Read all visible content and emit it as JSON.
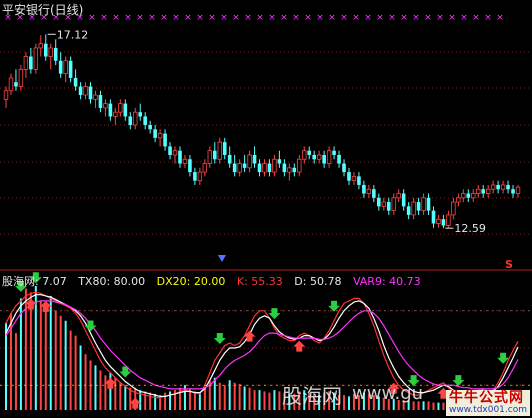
{
  "header": {
    "title": "平安银行(日线)"
  },
  "readout": {
    "indicator_name": "股海网",
    "line1": "7.07",
    "tx80": "TX80: 80.00",
    "dx20": "DX20: 20.00",
    "k": "K: 55.33",
    "d": "D: 50.78",
    "var9": "VAR9: 40.73"
  },
  "watermark": {
    "text": "股海网",
    "domain": "www.gu"
  },
  "brand": {
    "line1": "牛牛公式网",
    "line2": "www.tdx001.com"
  },
  "marker": {
    "s_label": "S"
  },
  "colors": {
    "up": "#ff4444",
    "down": "#54ffff",
    "grid": "#8b1a1a",
    "k_line": "#ff3333",
    "d_line": "#ffffff",
    "var9_line": "#ff33ff",
    "yellow": "#ffff00",
    "arrow_up": "#ff4444",
    "arrow_down": "#2ecc40",
    "cross": "#ff33ff"
  },
  "chart_data": {
    "type": "candlestick",
    "title": "平安银行(日线)",
    "price_annotations": [
      {
        "label": "17.12",
        "value": 17.12
      },
      {
        "label": "12.59",
        "value": 12.59
      }
    ],
    "price_ylim": [
      11.8,
      17.5
    ],
    "candles": [
      [
        15.6,
        15.9,
        15.4,
        15.8
      ],
      [
        15.8,
        16.2,
        15.7,
        16.1
      ],
      [
        16.0,
        16.3,
        15.8,
        15.9
      ],
      [
        15.9,
        16.4,
        15.8,
        16.3
      ],
      [
        16.3,
        16.7,
        16.1,
        16.6
      ],
      [
        16.6,
        16.8,
        16.2,
        16.3
      ],
      [
        16.3,
        16.9,
        16.2,
        16.8
      ],
      [
        16.8,
        17.1,
        16.6,
        16.9
      ],
      [
        16.9,
        17.12,
        16.5,
        16.6
      ],
      [
        16.6,
        16.9,
        16.3,
        16.8
      ],
      [
        16.8,
        17.0,
        16.4,
        16.5
      ],
      [
        16.5,
        16.7,
        16.1,
        16.2
      ],
      [
        16.2,
        16.6,
        16.0,
        16.5
      ],
      [
        16.5,
        16.6,
        16.0,
        16.1
      ],
      [
        16.1,
        16.3,
        15.8,
        15.9
      ],
      [
        15.9,
        16.0,
        15.6,
        15.7
      ],
      [
        15.7,
        16.0,
        15.6,
        15.9
      ],
      [
        15.9,
        16.0,
        15.5,
        15.6
      ],
      [
        15.6,
        15.8,
        15.4,
        15.7
      ],
      [
        15.7,
        15.8,
        15.3,
        15.4
      ],
      [
        15.4,
        15.6,
        15.2,
        15.5
      ],
      [
        15.5,
        15.6,
        15.1,
        15.2
      ],
      [
        15.2,
        15.4,
        15.0,
        15.3
      ],
      [
        15.3,
        15.6,
        15.2,
        15.5
      ],
      [
        15.5,
        15.6,
        15.1,
        15.2
      ],
      [
        15.2,
        15.3,
        14.9,
        15.0
      ],
      [
        15.0,
        15.4,
        14.9,
        15.3
      ],
      [
        15.3,
        15.5,
        15.1,
        15.2
      ],
      [
        15.2,
        15.3,
        14.9,
        15.0
      ],
      [
        15.0,
        15.1,
        14.8,
        14.9
      ],
      [
        14.9,
        15.0,
        14.6,
        14.7
      ],
      [
        14.7,
        14.9,
        14.5,
        14.8
      ],
      [
        14.8,
        14.9,
        14.4,
        14.5
      ],
      [
        14.5,
        14.6,
        14.2,
        14.3
      ],
      [
        14.3,
        14.5,
        14.1,
        14.4
      ],
      [
        14.4,
        14.5,
        14.0,
        14.1
      ],
      [
        14.1,
        14.3,
        14.0,
        14.2
      ],
      [
        14.2,
        14.3,
        13.8,
        13.9
      ],
      [
        13.9,
        14.0,
        13.6,
        13.7
      ],
      [
        13.7,
        14.0,
        13.6,
        13.9
      ],
      [
        13.9,
        14.2,
        13.8,
        14.1
      ],
      [
        14.1,
        14.5,
        14.0,
        14.4
      ],
      [
        14.4,
        14.6,
        14.1,
        14.2
      ],
      [
        14.2,
        14.7,
        14.1,
        14.6
      ],
      [
        14.6,
        14.7,
        14.2,
        14.3
      ],
      [
        14.3,
        14.5,
        14.0,
        14.1
      ],
      [
        14.1,
        14.3,
        13.8,
        13.9
      ],
      [
        13.9,
        14.2,
        13.8,
        14.1
      ],
      [
        14.1,
        14.3,
        13.9,
        14.0
      ],
      [
        14.0,
        14.4,
        13.9,
        14.3
      ],
      [
        14.3,
        14.5,
        14.0,
        14.1
      ],
      [
        14.1,
        14.2,
        13.8,
        13.9
      ],
      [
        13.9,
        14.2,
        13.8,
        14.1
      ],
      [
        14.1,
        14.2,
        13.8,
        13.9
      ],
      [
        13.9,
        14.3,
        13.8,
        14.2
      ],
      [
        14.2,
        14.4,
        14.0,
        14.1
      ],
      [
        14.1,
        14.2,
        13.8,
        13.9
      ],
      [
        13.9,
        14.1,
        13.7,
        14.0
      ],
      [
        14.0,
        14.1,
        13.8,
        13.9
      ],
      [
        13.9,
        14.3,
        13.8,
        14.2
      ],
      [
        14.2,
        14.5,
        14.1,
        14.4
      ],
      [
        14.4,
        14.5,
        14.2,
        14.3
      ],
      [
        14.3,
        14.4,
        14.1,
        14.2
      ],
      [
        14.2,
        14.4,
        14.1,
        14.3
      ],
      [
        14.3,
        14.4,
        14.0,
        14.1
      ],
      [
        14.1,
        14.5,
        14.0,
        14.4
      ],
      [
        14.4,
        14.5,
        14.2,
        14.3
      ],
      [
        14.3,
        14.4,
        14.0,
        14.1
      ],
      [
        14.1,
        14.2,
        13.8,
        13.9
      ],
      [
        13.9,
        14.0,
        13.6,
        13.7
      ],
      [
        13.7,
        13.9,
        13.6,
        13.8
      ],
      [
        13.8,
        13.9,
        13.5,
        13.6
      ],
      [
        13.6,
        13.7,
        13.3,
        13.4
      ],
      [
        13.4,
        13.6,
        13.3,
        13.5
      ],
      [
        13.5,
        13.6,
        13.2,
        13.3
      ],
      [
        13.3,
        13.4,
        13.0,
        13.1
      ],
      [
        13.1,
        13.3,
        13.0,
        13.2
      ],
      [
        13.2,
        13.3,
        12.9,
        13.0
      ],
      [
        13.0,
        13.4,
        12.9,
        13.3
      ],
      [
        13.3,
        13.5,
        13.2,
        13.4
      ],
      [
        13.4,
        13.5,
        13.0,
        13.1
      ],
      [
        13.1,
        13.2,
        12.8,
        12.9
      ],
      [
        12.9,
        13.3,
        12.8,
        13.2
      ],
      [
        13.2,
        13.3,
        12.9,
        13.0
      ],
      [
        13.0,
        13.4,
        12.9,
        13.3
      ],
      [
        13.3,
        13.4,
        12.9,
        13.0
      ],
      [
        13.0,
        13.1,
        12.6,
        12.7
      ],
      [
        12.7,
        12.9,
        12.6,
        12.8
      ],
      [
        12.8,
        12.9,
        12.59,
        12.65
      ],
      [
        12.65,
        13.0,
        12.6,
        12.9
      ],
      [
        12.9,
        13.3,
        12.8,
        13.2
      ],
      [
        13.2,
        13.4,
        13.1,
        13.3
      ],
      [
        13.3,
        13.5,
        13.2,
        13.4
      ],
      [
        13.4,
        13.5,
        13.2,
        13.3
      ],
      [
        13.3,
        13.5,
        13.2,
        13.4
      ],
      [
        13.4,
        13.6,
        13.3,
        13.5
      ],
      [
        13.5,
        13.6,
        13.3,
        13.4
      ],
      [
        13.4,
        13.6,
        13.3,
        13.5
      ],
      [
        13.5,
        13.7,
        13.4,
        13.6
      ],
      [
        13.6,
        13.7,
        13.4,
        13.5
      ],
      [
        13.5,
        13.7,
        13.4,
        13.6
      ],
      [
        13.6,
        13.7,
        13.4,
        13.5
      ],
      [
        13.5,
        13.6,
        13.3,
        13.4
      ],
      [
        13.4,
        13.6,
        13.3,
        13.55
      ]
    ],
    "indicator": {
      "name": "股海网",
      "reference_levels": [
        {
          "name": "TX80",
          "value": 80
        },
        {
          "name": "DX20",
          "value": 20
        }
      ],
      "series": [
        {
          "name": "K",
          "values": [
            70,
            78,
            84,
            88,
            92,
            94,
            95,
            94,
            92,
            90,
            88,
            86,
            84,
            82,
            78,
            72,
            64,
            56,
            48,
            40,
            34,
            30,
            26,
            22,
            19,
            16,
            14,
            13,
            12,
            11,
            10,
            10,
            11,
            12,
            13,
            15,
            16,
            15,
            14,
            13,
            20,
            30,
            40,
            46,
            52,
            54,
            52,
            54,
            60,
            68,
            76,
            80,
            80,
            74,
            66,
            60,
            58,
            56,
            56,
            60,
            62,
            60,
            56,
            54,
            58,
            64,
            72,
            80,
            86,
            88,
            90,
            90,
            86,
            78,
            68,
            56,
            44,
            34,
            26,
            20,
            16,
            14,
            12,
            12,
            14,
            16,
            18,
            20,
            22,
            18,
            14,
            12,
            11,
            12,
            14,
            16,
            16,
            14,
            16,
            22,
            30,
            40,
            48,
            55.33
          ]
        },
        {
          "name": "D",
          "values": [
            62,
            70,
            78,
            84,
            88,
            91,
            93,
            93,
            92,
            91,
            89,
            87,
            85,
            83,
            80,
            76,
            70,
            62,
            54,
            47,
            40,
            35,
            31,
            27,
            23,
            20,
            17,
            15,
            14,
            13,
            12,
            11,
            11,
            12,
            13,
            14,
            15,
            15,
            14,
            14,
            17,
            24,
            32,
            40,
            46,
            50,
            50,
            51,
            55,
            61,
            69,
            74,
            76,
            74,
            68,
            63,
            60,
            58,
            57,
            58,
            60,
            60,
            58,
            56,
            57,
            61,
            67,
            74,
            80,
            84,
            87,
            88,
            86,
            82,
            74,
            64,
            52,
            42,
            34,
            27,
            22,
            18,
            15,
            14,
            14,
            15,
            16,
            18,
            20,
            19,
            16,
            14,
            13,
            13,
            14,
            15,
            16,
            15,
            15,
            19,
            26,
            34,
            42,
            50.78
          ]
        },
        {
          "name": "VAR9",
          "values": [
            60,
            66,
            72,
            78,
            82,
            85,
            87,
            88,
            88,
            88,
            87,
            86,
            85,
            83,
            81,
            78,
            74,
            69,
            64,
            58,
            53,
            48,
            44,
            40,
            36,
            32,
            29,
            26,
            24,
            22,
            20,
            19,
            18,
            17,
            17,
            17,
            17,
            17,
            17,
            17,
            18,
            20,
            24,
            28,
            33,
            37,
            40,
            42,
            44,
            47,
            51,
            56,
            60,
            62,
            62,
            61,
            60,
            59,
            58,
            58,
            58,
            58,
            58,
            57,
            57,
            58,
            60,
            63,
            67,
            71,
            75,
            78,
            80,
            80,
            78,
            74,
            68,
            61,
            54,
            47,
            41,
            36,
            32,
            28,
            25,
            23,
            21,
            20,
            20,
            20,
            20,
            19,
            18,
            18,
            17,
            17,
            17,
            17,
            17,
            18,
            21,
            26,
            33,
            40.73
          ]
        }
      ],
      "bars": [
        70,
        78,
        62,
        90,
        98,
        95,
        100,
        88,
        84,
        92,
        80,
        76,
        72,
        64,
        60,
        52,
        45,
        40,
        36,
        32,
        28,
        30,
        26,
        22,
        20,
        18,
        18,
        16,
        15,
        14,
        13,
        12,
        14,
        15,
        16,
        18,
        20,
        17,
        15,
        14,
        18,
        24,
        26,
        22,
        20,
        24,
        22,
        21,
        19,
        18,
        16,
        16,
        15,
        14,
        16,
        15,
        14,
        13,
        13,
        15,
        16,
        14,
        13,
        12,
        14,
        15,
        14,
        12,
        12,
        11,
        13,
        12,
        14,
        13,
        12,
        11,
        10,
        9,
        9,
        8,
        8,
        8,
        7,
        7,
        7,
        7,
        6,
        6,
        6,
        6,
        6,
        6,
        5,
        5,
        5,
        5,
        6,
        6,
        6,
        7,
        7,
        8,
        8,
        8
      ],
      "buy_signals": [
        5,
        8,
        21,
        26,
        49,
        59,
        78,
        88,
        96
      ],
      "sell_signals": [
        3,
        6,
        17,
        24,
        43,
        54,
        66,
        82,
        91,
        100
      ]
    }
  }
}
